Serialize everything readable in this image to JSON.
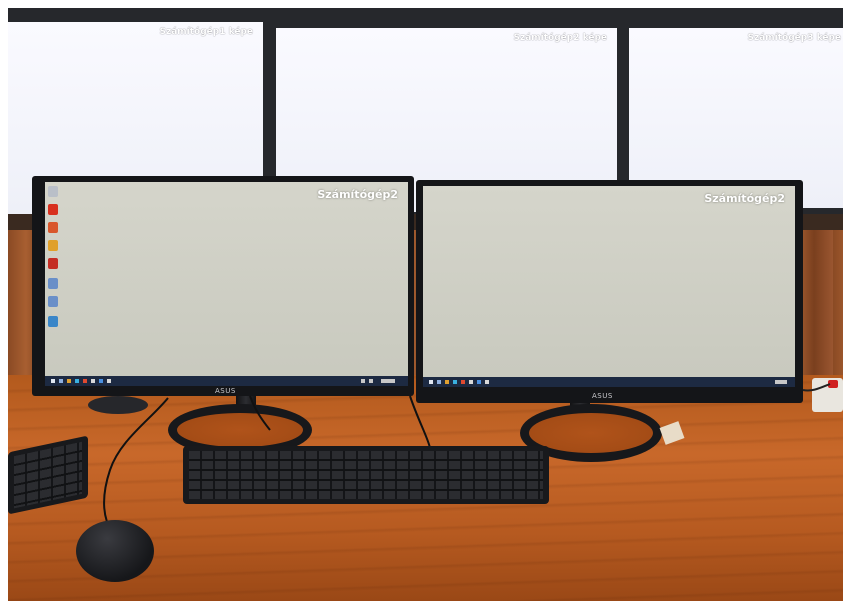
{
  "video_wall": {
    "screen1_label": "Számítógép1 képe",
    "screen2_label": "Számítógép2 képe",
    "screen3_label": "Számítógép3 képe"
  },
  "monitors": {
    "left_label": "Számítógép2",
    "right_label": "Számítógép2",
    "left_brand": "ASUS",
    "right_brand": "ASUS"
  },
  "colors": {
    "wall_screen": "#f4f5fb",
    "monitor_screen": "#cfd0c6",
    "bezel": "#141518",
    "desk": "#bd6124",
    "taskbar": "#1d2a42"
  },
  "icons": [
    "acrobat-icon",
    "folder-icon",
    "chrome-icon",
    "app-icon",
    "printer-icon",
    "printer-icon",
    "network-icon"
  ]
}
